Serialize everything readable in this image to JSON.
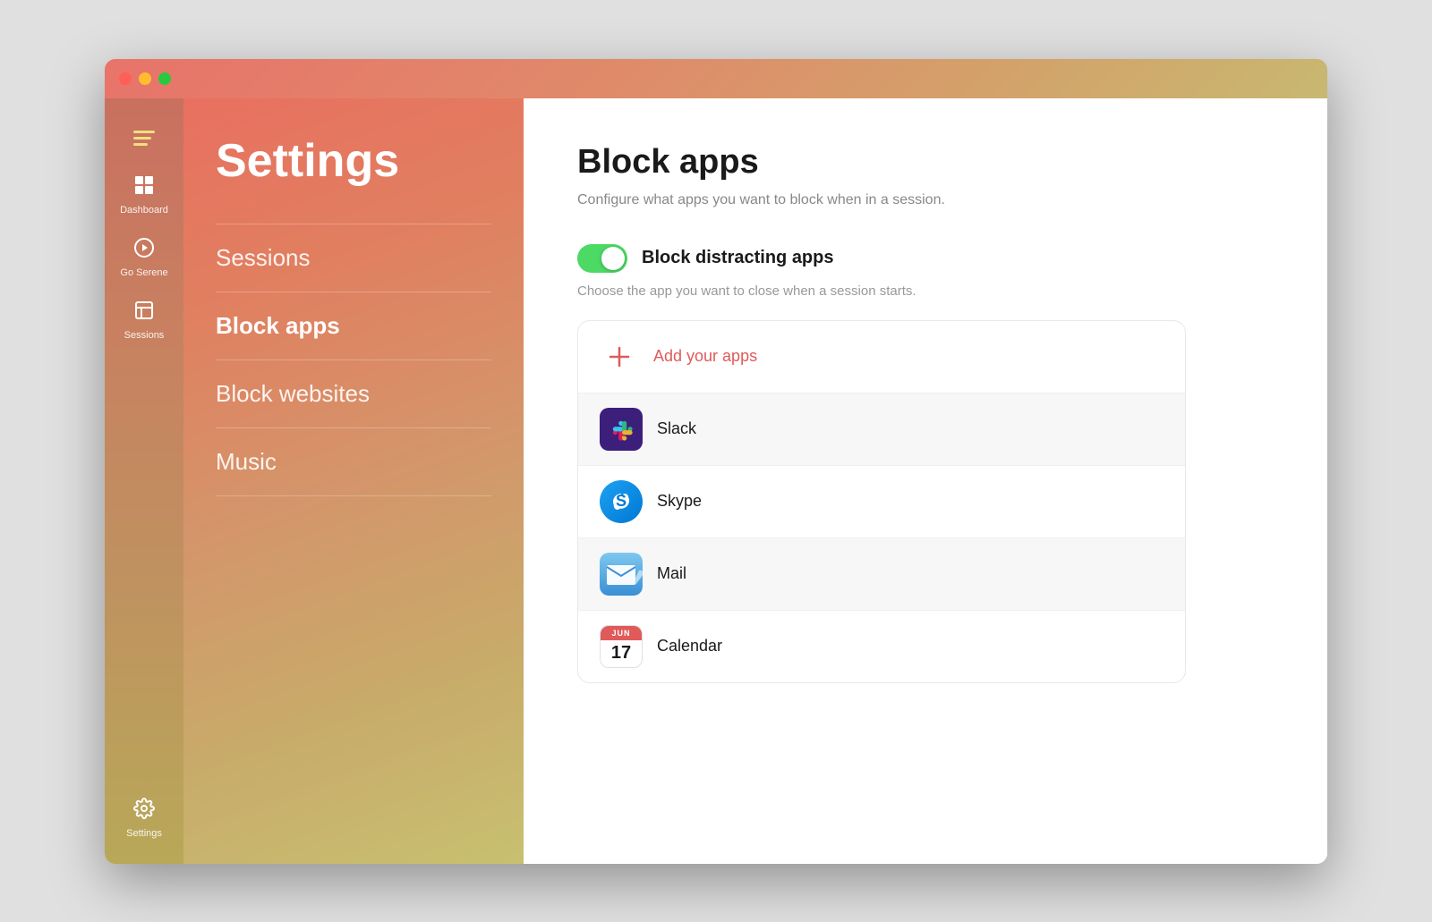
{
  "window": {
    "title": "Settings"
  },
  "titleBar": {
    "trafficLights": [
      "close",
      "minimize",
      "maximize"
    ]
  },
  "sidebarIcons": {
    "items": [
      {
        "id": "dashboard",
        "label": "Dashboard",
        "icon": "grid"
      },
      {
        "id": "go-serene",
        "label": "Go Serene",
        "icon": "play"
      },
      {
        "id": "sessions",
        "label": "Sessions",
        "icon": "sessions"
      },
      {
        "id": "settings",
        "label": "Settings",
        "icon": "gear",
        "position": "bottom"
      }
    ]
  },
  "settingsSidebar": {
    "title": "Settings",
    "navItems": [
      {
        "id": "sessions",
        "label": "Sessions",
        "active": false
      },
      {
        "id": "block-apps",
        "label": "Block apps",
        "active": true
      },
      {
        "id": "block-websites",
        "label": "Block websites",
        "active": false
      },
      {
        "id": "music",
        "label": "Music",
        "active": false
      }
    ]
  },
  "content": {
    "title": "Block apps",
    "subtitle": "Configure what apps you want to block when in a session.",
    "toggle": {
      "enabled": true,
      "label": "Block distracting apps",
      "sublabel": "Choose the app you want to close when a session starts."
    },
    "addButton": {
      "label": "Add your apps",
      "icon": "plus"
    },
    "appsList": [
      {
        "id": "slack",
        "name": "Slack",
        "iconType": "slack"
      },
      {
        "id": "skype",
        "name": "Skype",
        "iconType": "skype"
      },
      {
        "id": "mail",
        "name": "Mail",
        "iconType": "mail"
      },
      {
        "id": "calendar",
        "name": "Calendar",
        "iconType": "calendar",
        "calDate": "17",
        "calMonth": "JUN"
      }
    ]
  },
  "colors": {
    "accent": "#e05a5a",
    "toggleOn": "#4cd964",
    "sidebarGradientStart": "#e87060",
    "sidebarGradientEnd": "#c8c070"
  }
}
